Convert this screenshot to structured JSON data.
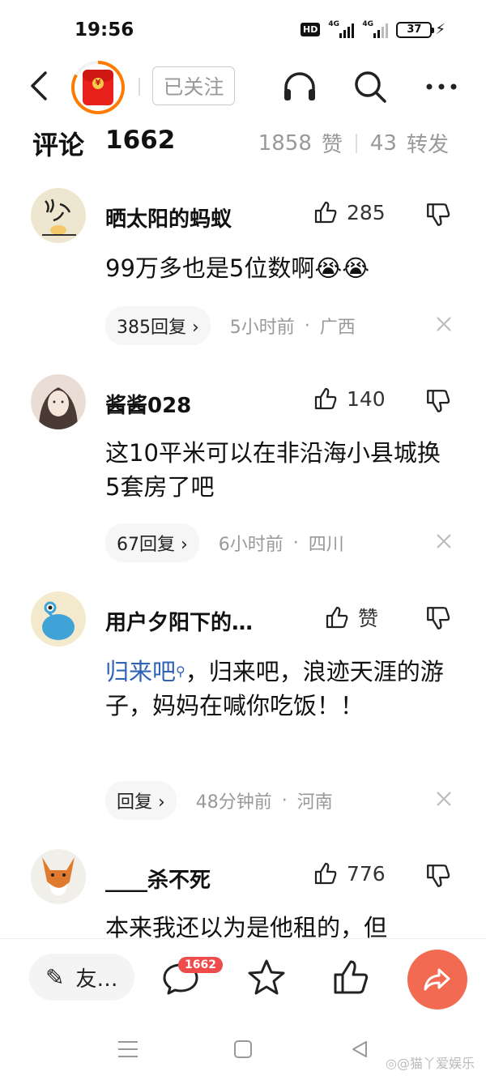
{
  "status_bar": {
    "time": "19:56",
    "hd_label": "HD",
    "net1": "4G",
    "net2": "4G",
    "battery": "37"
  },
  "header": {
    "follow_label": "已关注"
  },
  "summary": {
    "title": "评论",
    "count": "1662",
    "likes": "1858",
    "likes_label": "赞",
    "reposts": "43",
    "reposts_label": "转发"
  },
  "comments": [
    {
      "name": "晒太阳的蚂蚁",
      "likes": "285",
      "text": "99万多也是5位数啊😭😭",
      "reply": "385回复 ›",
      "time": "5小时前",
      "location": "广西"
    },
    {
      "name": "酱酱028",
      "likes": "140",
      "text": "这10平米可以在非沿海小县城换5套房了吧",
      "reply": "67回复 ›",
      "time": "6小时前",
      "location": "四川"
    },
    {
      "name": "用户夕阳下的…",
      "likes": "赞",
      "topic": "归来吧",
      "text": "，归来吧，浪迹天涯的游子，妈妈在喊你吃饭！！",
      "reply": "回复 ›",
      "time": "48分钟前",
      "location": "河南"
    },
    {
      "name": "____杀不死",
      "likes": "776",
      "text": "本来我还以为是他租的，但"
    }
  ],
  "bottom_bar": {
    "input_label": "友…",
    "comment_badge": "1662"
  },
  "watermark": "◎@猫丫爱娱乐",
  "colors": {
    "accent": "#f36a53",
    "topic_link": "#2f63b5",
    "badge": "#ef4b4b"
  }
}
